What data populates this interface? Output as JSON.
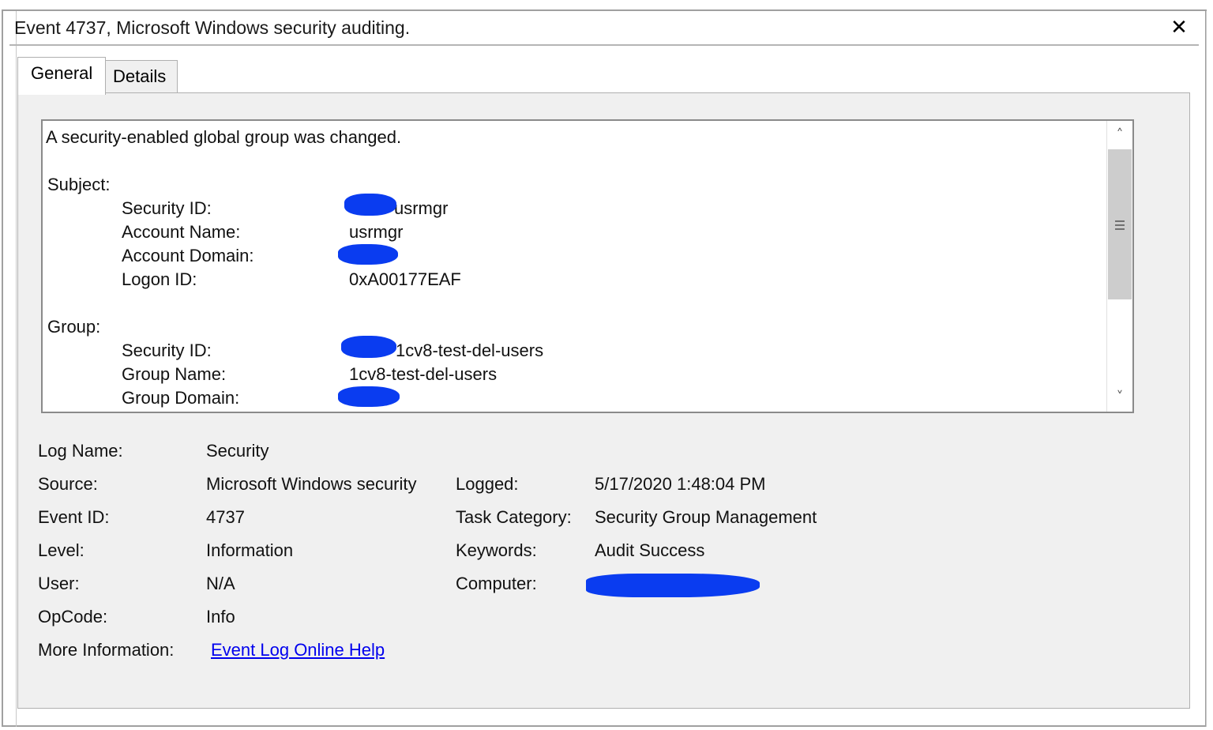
{
  "window": {
    "title": "Event 4737, Microsoft Windows security auditing.",
    "close_glyph": "✕"
  },
  "tabs": [
    {
      "label": "General",
      "active": true
    },
    {
      "label": "Details",
      "active": false
    }
  ],
  "description": {
    "headline": "A security-enabled global group was changed.",
    "subject_heading": "Subject:",
    "subject": [
      {
        "label": "Security ID:",
        "value": "usrmgr",
        "redacted_prefix": true
      },
      {
        "label": "Account Name:",
        "value": "usrmgr"
      },
      {
        "label": "Account Domain:",
        "value": "",
        "redacted": true
      },
      {
        "label": "Logon ID:",
        "value": "0xA00177EAF"
      }
    ],
    "group_heading": "Group:",
    "group": [
      {
        "label": "Security ID:",
        "value": "1cv8-test-del-users",
        "redacted_prefix": true
      },
      {
        "label": "Group Name:",
        "value": "1cv8-test-del-users"
      },
      {
        "label": "Group Domain:",
        "value": "",
        "redacted": true
      }
    ]
  },
  "scrollbar": {
    "up_glyph": "˄",
    "down_glyph": "˅"
  },
  "details": {
    "log_name_label": "Log Name:",
    "log_name": "Security",
    "source_label": "Source:",
    "source": "Microsoft Windows security",
    "logged_label": "Logged:",
    "logged": "5/17/2020 1:48:04 PM",
    "event_id_label": "Event ID:",
    "event_id": "4737",
    "task_category_label": "Task Category:",
    "task_category": "Security Group Management",
    "level_label": "Level:",
    "level": "Information",
    "keywords_label": "Keywords:",
    "keywords": "Audit Success",
    "user_label": "User:",
    "user": "N/A",
    "computer_label": "Computer:",
    "computer": "",
    "opcode_label": "OpCode:",
    "opcode": "Info",
    "more_info_label": "More Information:",
    "more_info_link": "Event Log Online Help"
  },
  "colors": {
    "redaction": "#0a3cf0",
    "link": "#0000ee"
  }
}
